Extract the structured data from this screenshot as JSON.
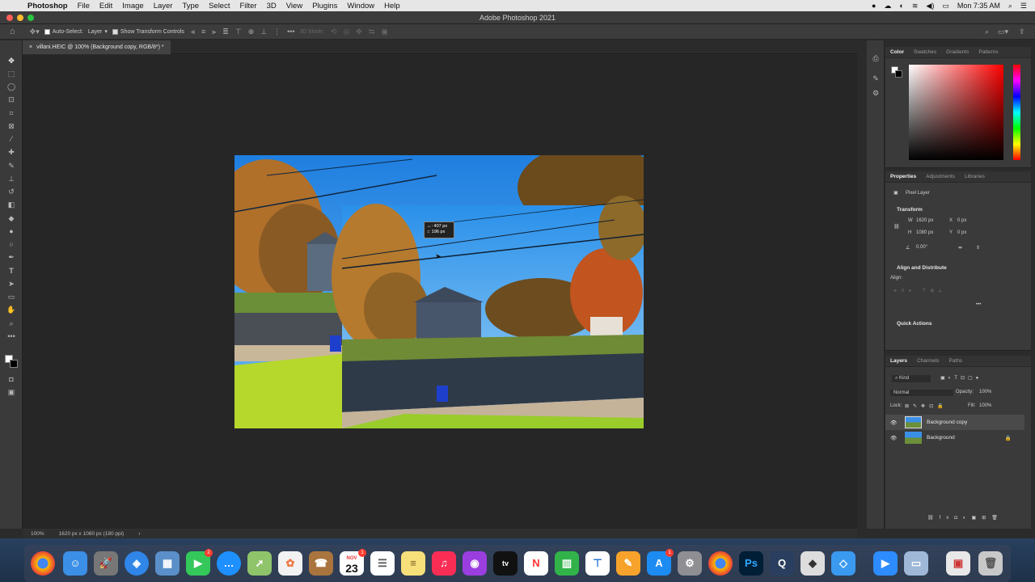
{
  "menubar": {
    "app_name": "Photoshop",
    "menus": [
      "File",
      "Edit",
      "Image",
      "Layer",
      "Type",
      "Select",
      "Filter",
      "3D",
      "View",
      "Plugins",
      "Window",
      "Help"
    ],
    "clock": "Mon 7:35 AM"
  },
  "window": {
    "title": "Adobe Photoshop 2021"
  },
  "options": {
    "auto_select_label": "Auto-Select:",
    "auto_select_value": "Layer",
    "show_transform_label": "Show Transform Controls",
    "mode_3d_label": "3D Mode:"
  },
  "document": {
    "tab_label": "villani.HEIC @ 100% (Background copy, RGB/8*) *",
    "close_glyph": "×"
  },
  "tooltip": {
    "dx": "↔: 407 px",
    "dy": "↕: 196 px"
  },
  "status": {
    "zoom": "100%",
    "doc_info": "1620 px x 1080 px (180 ppi)",
    "arrow": "›"
  },
  "color_panel": {
    "tabs": [
      "Color",
      "Swatches",
      "Gradients",
      "Patterns"
    ]
  },
  "properties_panel": {
    "tabs": [
      "Properties",
      "Adjustments",
      "Libraries"
    ],
    "layer_type": "Pixel Layer",
    "transform_title": "Transform",
    "w_label": "W",
    "w_value": "1620 px",
    "h_label": "H",
    "h_value": "1080 px",
    "x_label": "X",
    "x_value": "0 px",
    "y_label": "Y",
    "y_value": "0 px",
    "angle_value": "0.00°",
    "align_title": "Align and Distribute",
    "align_label": "Align:",
    "quick_actions_title": "Quick Actions"
  },
  "layers_panel": {
    "tabs": [
      "Layers",
      "Channels",
      "Paths"
    ],
    "filter_kind": "Kind",
    "blend_mode": "Normal",
    "opacity_label": "Opacity:",
    "opacity_value": "100%",
    "lock_label": "Lock:",
    "fill_label": "Fill:",
    "fill_value": "100%",
    "layers": [
      {
        "name": "Background copy",
        "selected": true,
        "locked": false
      },
      {
        "name": "Background",
        "selected": false,
        "locked": true
      }
    ]
  },
  "dock": {
    "badges": {
      "facetime": "2",
      "calendar": "1",
      "appstore": "1"
    },
    "calendar_month": "NOV",
    "calendar_day": "23",
    "ps_label": "Ps",
    "tv_label": "tv"
  },
  "colors": {
    "accent": "#1473e6",
    "panel_bg": "#3a3a3a",
    "canvas_bg": "#262626",
    "foreground_swatch": "#ffffff",
    "background_swatch": "#000000"
  }
}
